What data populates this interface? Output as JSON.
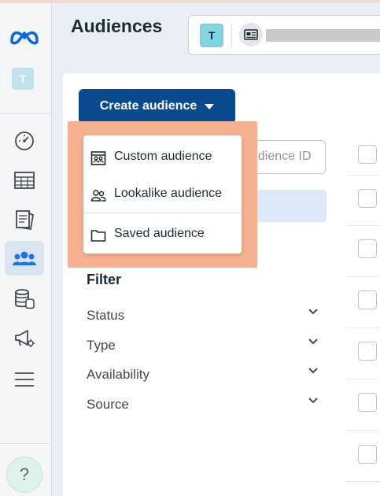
{
  "page": {
    "title": "Audiences"
  },
  "account": {
    "avatar_letter": "T"
  },
  "sidebar": {
    "avatar_letter": "T",
    "items": [
      {
        "name": "dashboard"
      },
      {
        "name": "ads-manager"
      },
      {
        "name": "catalog"
      },
      {
        "name": "audiences"
      },
      {
        "name": "billing"
      },
      {
        "name": "campaign"
      },
      {
        "name": "menu"
      }
    ],
    "help_label": "?"
  },
  "toolbar": {
    "create_label": "Create audience"
  },
  "search": {
    "visible_text": "udience ID"
  },
  "dropdown": {
    "items": [
      {
        "label": "Custom audience",
        "icon": "custom-audience-icon"
      },
      {
        "label": "Lookalike audience",
        "icon": "lookalike-audience-icon"
      },
      {
        "label": "Saved audience",
        "icon": "folder-icon"
      }
    ]
  },
  "filter": {
    "title": "Filter",
    "rows": [
      {
        "label": "Status"
      },
      {
        "label": "Type"
      },
      {
        "label": "Availability"
      },
      {
        "label": "Source"
      }
    ]
  },
  "colors": {
    "brand": "#0a4a8f",
    "meta_blue": "#0668e1",
    "highlight": "#f6b190",
    "active_nav": "#1b74e4"
  }
}
